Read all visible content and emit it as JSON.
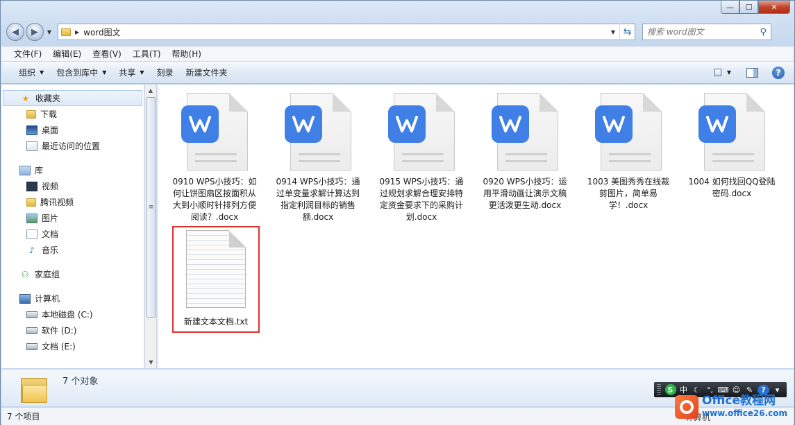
{
  "window": {
    "minimize_glyph": "—",
    "maximize_glyph": "☐",
    "close_glyph": "✕"
  },
  "address": {
    "path_segment": "word图文",
    "search_placeholder": "搜索 word图文"
  },
  "menu": [
    "文件(F)",
    "编辑(E)",
    "查看(V)",
    "工具(T)",
    "帮助(H)"
  ],
  "toolbar": {
    "organize": "组织",
    "include_in_library": "包含到库中",
    "share": "共享",
    "burn": "刻录",
    "new_folder": "新建文件夹"
  },
  "nav": {
    "favorites": "收藏夹",
    "downloads": "下载",
    "desktop": "桌面",
    "recent": "最近访问的位置",
    "libraries": "库",
    "videos": "视频",
    "tencent_video": "腾讯视频",
    "pictures": "图片",
    "documents": "文档",
    "music": "音乐",
    "homegroup": "家庭组",
    "computer": "计算机",
    "local_disk_c": "本地磁盘 (C:)",
    "software_d": "软件 (D:)",
    "docs_e": "文档 (E:)"
  },
  "files": [
    {
      "name": "0910 WPS小技巧：如何让饼图扇区按面积从大到小顺时针排列方便阅读？.docx",
      "type": "wps"
    },
    {
      "name": "0914  WPS小技巧：通过单变量求解计算达到指定利润目标的销售额.docx",
      "type": "wps"
    },
    {
      "name": "0915 WPS小技巧：通过规划求解合理安排特定资金要求下的采购计划.docx",
      "type": "wps"
    },
    {
      "name": "0920 WPS小技巧：运用平滑动画让演示文稿更活泼更生动.docx",
      "type": "wps"
    },
    {
      "name": "1003 美图秀秀在线裁剪图片，简单易学！.docx",
      "type": "wps"
    },
    {
      "name": "1004 如何找回QQ登陆密码.docx",
      "type": "wps"
    },
    {
      "name": "新建文本文档.txt",
      "type": "txt",
      "highlighted": true
    }
  ],
  "details": {
    "object_count": "7 个对象"
  },
  "status": {
    "items_count": "7 个项目",
    "location": "计算机"
  },
  "ime": {
    "mode": "中",
    "punct": "°,",
    "help": "?"
  },
  "watermark": {
    "title": "Office教程网",
    "url": "www.office26.com"
  },
  "colors": {
    "wps_blue": "#3f7fe6",
    "highlight_red": "#e0302a",
    "watermark_orange": "#e3421d"
  }
}
